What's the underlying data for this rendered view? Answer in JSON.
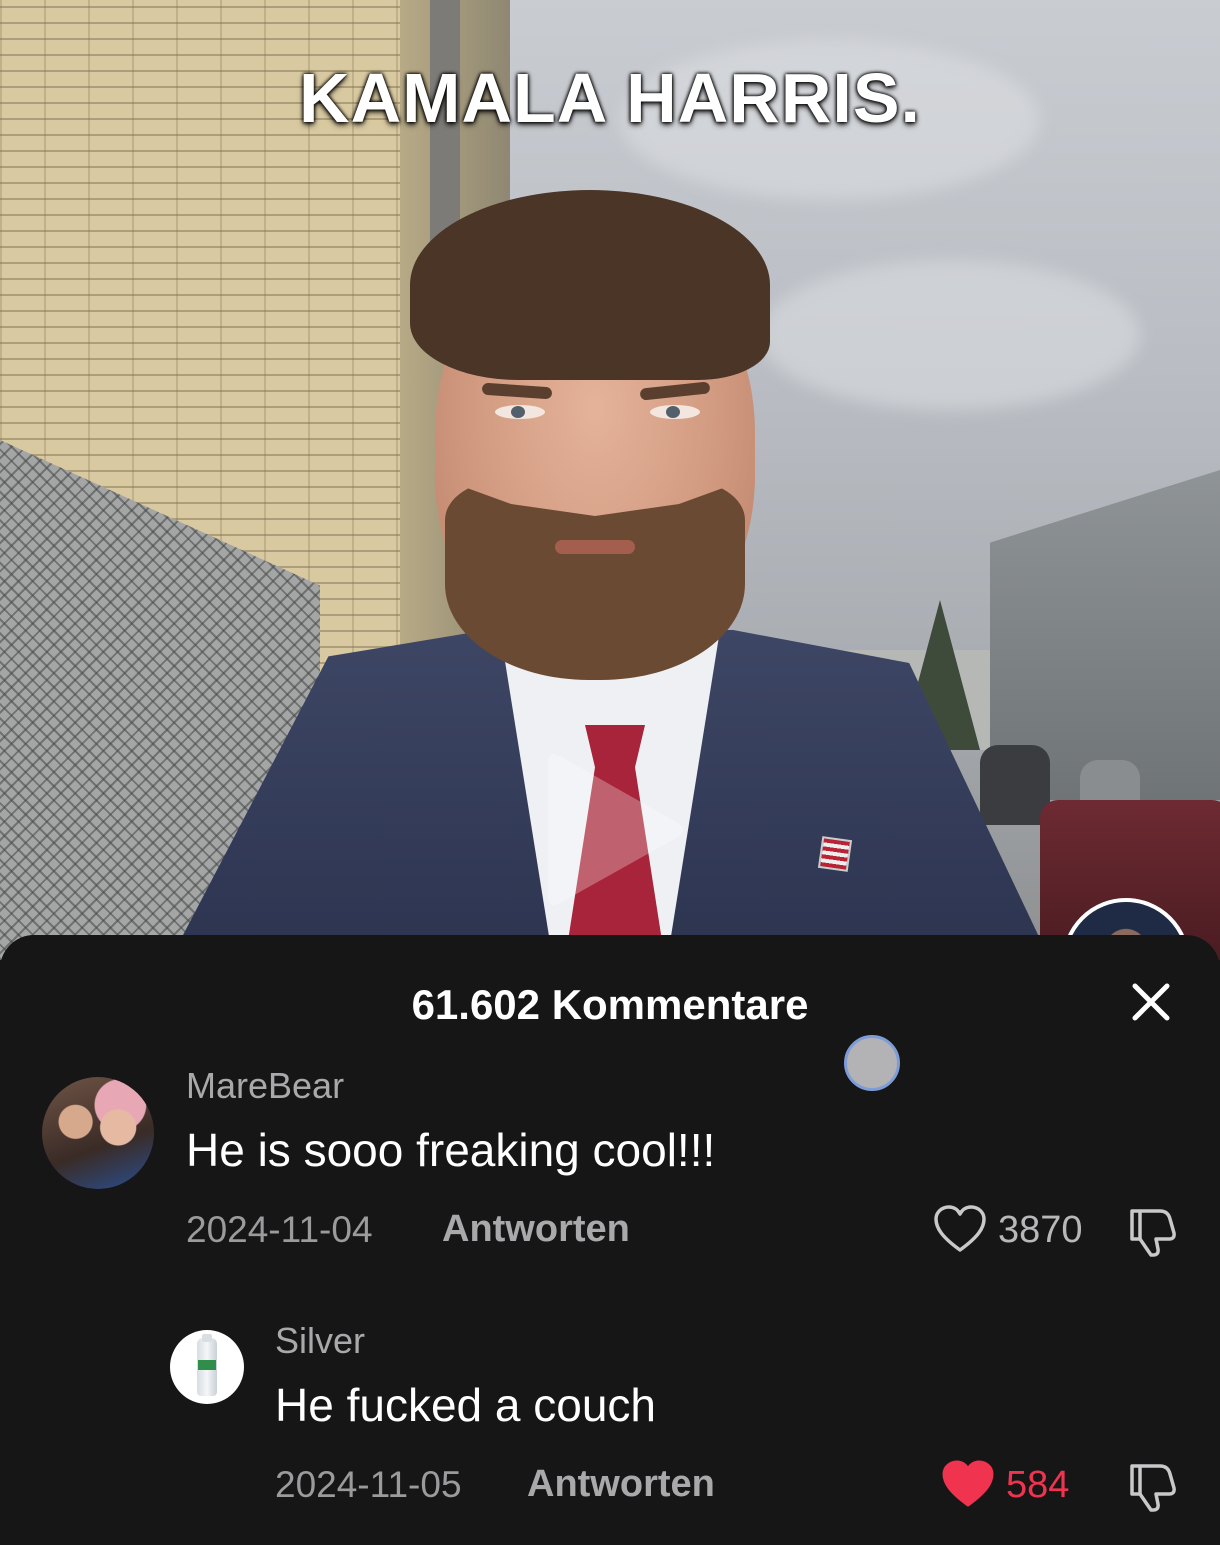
{
  "video": {
    "caption": "KAMALA HARRIS."
  },
  "comments_sheet": {
    "title": "61.602 Kommentare",
    "comments": [
      {
        "username": "MareBear",
        "text": "He is sooo freaking cool!!!",
        "date": "2024-11-04",
        "reply_label": "Antworten",
        "likes": "3870",
        "liked": false
      },
      {
        "username": "Silver",
        "text": "He fucked a couch",
        "date": "2024-11-05",
        "reply_label": "Antworten",
        "likes": "584",
        "liked": true
      }
    ]
  },
  "colors": {
    "sheet_background": "#161616",
    "liked_red": "#f0344f",
    "muted_text": "#a9a9ab"
  }
}
